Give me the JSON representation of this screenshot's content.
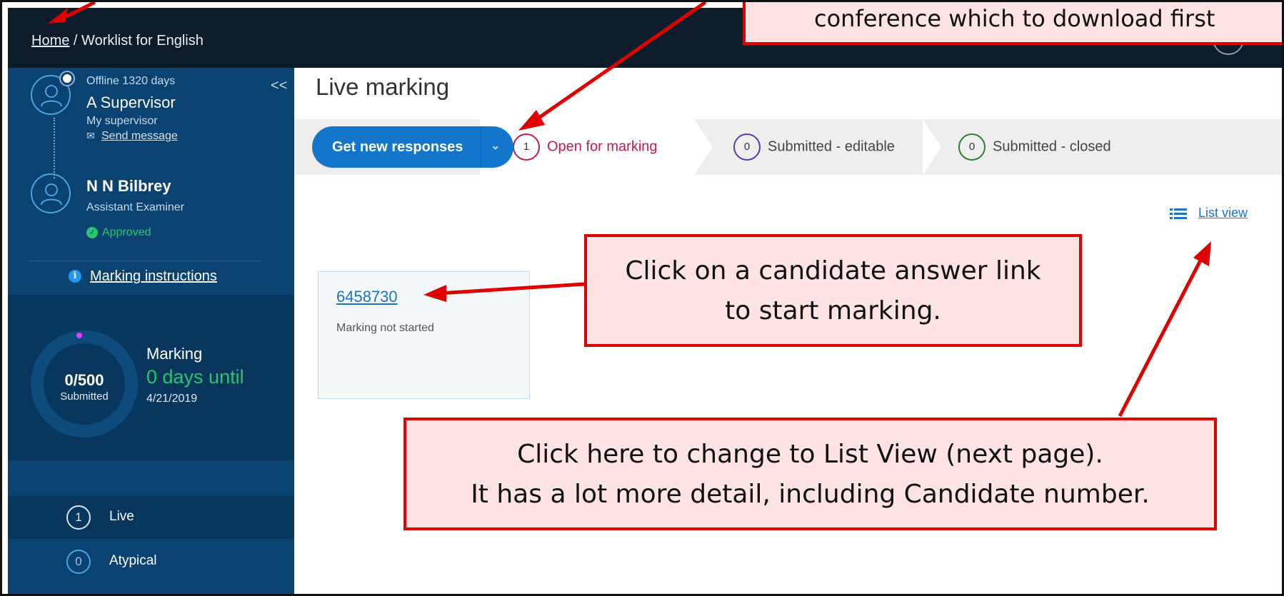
{
  "breadcrumb": {
    "home": "Home",
    "separator": "/",
    "current": "Worklist for English"
  },
  "sidebar": {
    "collapse_glyph": "<<",
    "supervisor": {
      "status": "Offline 1320 days",
      "name": "A Supervisor",
      "role": "My supervisor",
      "send_message": "Send message"
    },
    "examiner": {
      "name": "N N Bilbrey",
      "role": "Assistant Examiner",
      "status": "Approved"
    },
    "marking_instructions": "Marking instructions",
    "progress": {
      "value": "0/500",
      "label": "Submitted",
      "title": "Marking",
      "days": "0 days until",
      "date": "4/21/2019"
    },
    "nav": [
      {
        "count": "1",
        "label": "Live"
      },
      {
        "count": "0",
        "label": "Atypical"
      }
    ]
  },
  "main": {
    "title": "Live marking",
    "get_button": "Get new responses",
    "steps": [
      {
        "count": "1",
        "label": "Open for marking",
        "color": "#c2185b"
      },
      {
        "count": "0",
        "label": "Submitted - editable",
        "color": "#5e35b1"
      },
      {
        "count": "0",
        "label": "Submitted - closed",
        "color": "#2e7d32"
      }
    ],
    "list_view": "List view",
    "card": {
      "id": "6458730",
      "status": "Marking not started"
    }
  },
  "annotations": {
    "top": "conference which to download first",
    "card_line1": "Click on a candidate answer link",
    "card_line2": "to start marking.",
    "list_line1": "Click here to change to List View (next page).",
    "list_line2": "It has a lot more detail, including Candidate number."
  },
  "colors": {
    "accent": "#1376cc",
    "annotation_border": "#e00000",
    "annotation_fill": "#fde3e3"
  }
}
